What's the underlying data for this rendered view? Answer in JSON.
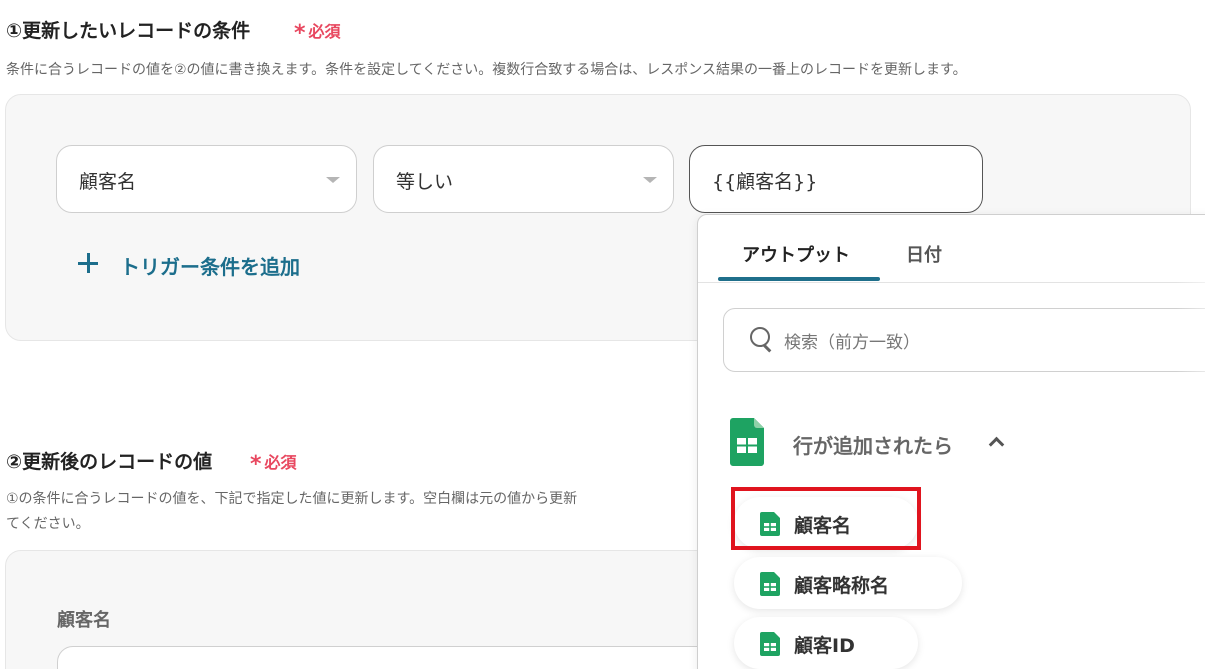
{
  "section1": {
    "title": "①更新したいレコードの条件",
    "required": "必須",
    "description": "条件に合うレコードの値を②の値に書き換えます。条件を設定してください。複数行合致する場合は、レスポンス結果の一番上のレコードを更新します。",
    "condition": {
      "field_value": "顧客名",
      "operator_value": "等しい",
      "input_value": "{{顧客名}}"
    },
    "add_condition_label": "トリガー条件を追加"
  },
  "section2": {
    "title": "②更新後のレコードの値",
    "required": "必須",
    "description_line1": "①の条件に合うレコードの値を、下記で指定した値に更新します。空白欄は元の値から更新",
    "description_line2": "てください。",
    "field_label": "顧客名"
  },
  "dropdown": {
    "tabs": [
      {
        "label": "アウトプット",
        "active": true
      },
      {
        "label": "日付",
        "active": false
      }
    ],
    "search_placeholder": "検索（前方一致）",
    "group": {
      "label": "行が追加されたら",
      "icon": "google-sheets-icon",
      "expanded": true
    },
    "items": [
      {
        "label": "顧客名",
        "highlighted": true
      },
      {
        "label": "顧客略称名",
        "highlighted": false
      },
      {
        "label": "顧客ID",
        "highlighted": false
      }
    ]
  },
  "colors": {
    "accent": "#1c6e8c",
    "required": "#e8475f",
    "sheets_green": "#1ea362",
    "highlight_box": "#e0141e"
  }
}
